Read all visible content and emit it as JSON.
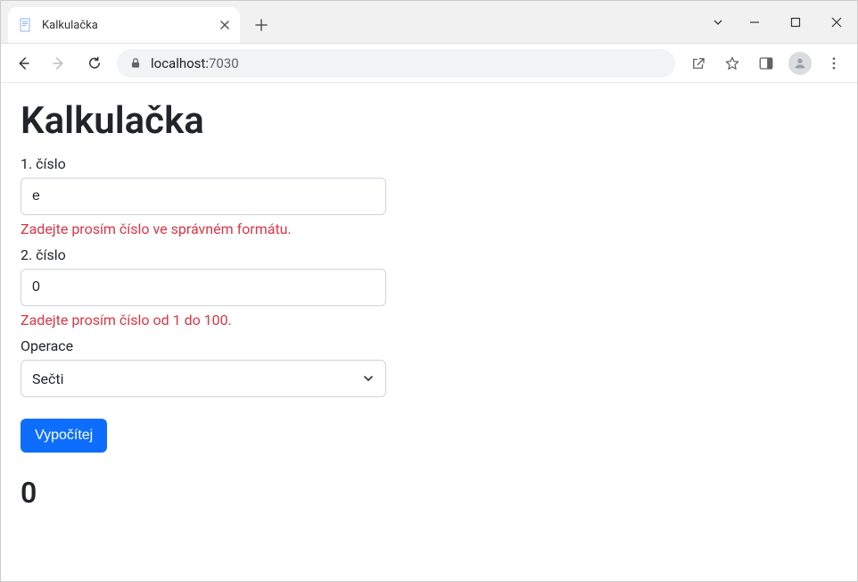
{
  "window": {
    "tab_title": "Kalkulačka"
  },
  "address": {
    "host": "localhost:",
    "port": "7030"
  },
  "page": {
    "heading": "Kalkulačka",
    "field1": {
      "label": "1. číslo",
      "value": "e",
      "error": "Zadejte prosím číslo ve správném formátu."
    },
    "field2": {
      "label": "2. číslo",
      "value": "0",
      "error": "Zadejte prosím číslo od 1 do 100."
    },
    "operation": {
      "label": "Operace",
      "selected": "Sečti"
    },
    "submit_label": "Vypočítej",
    "result": "0"
  }
}
